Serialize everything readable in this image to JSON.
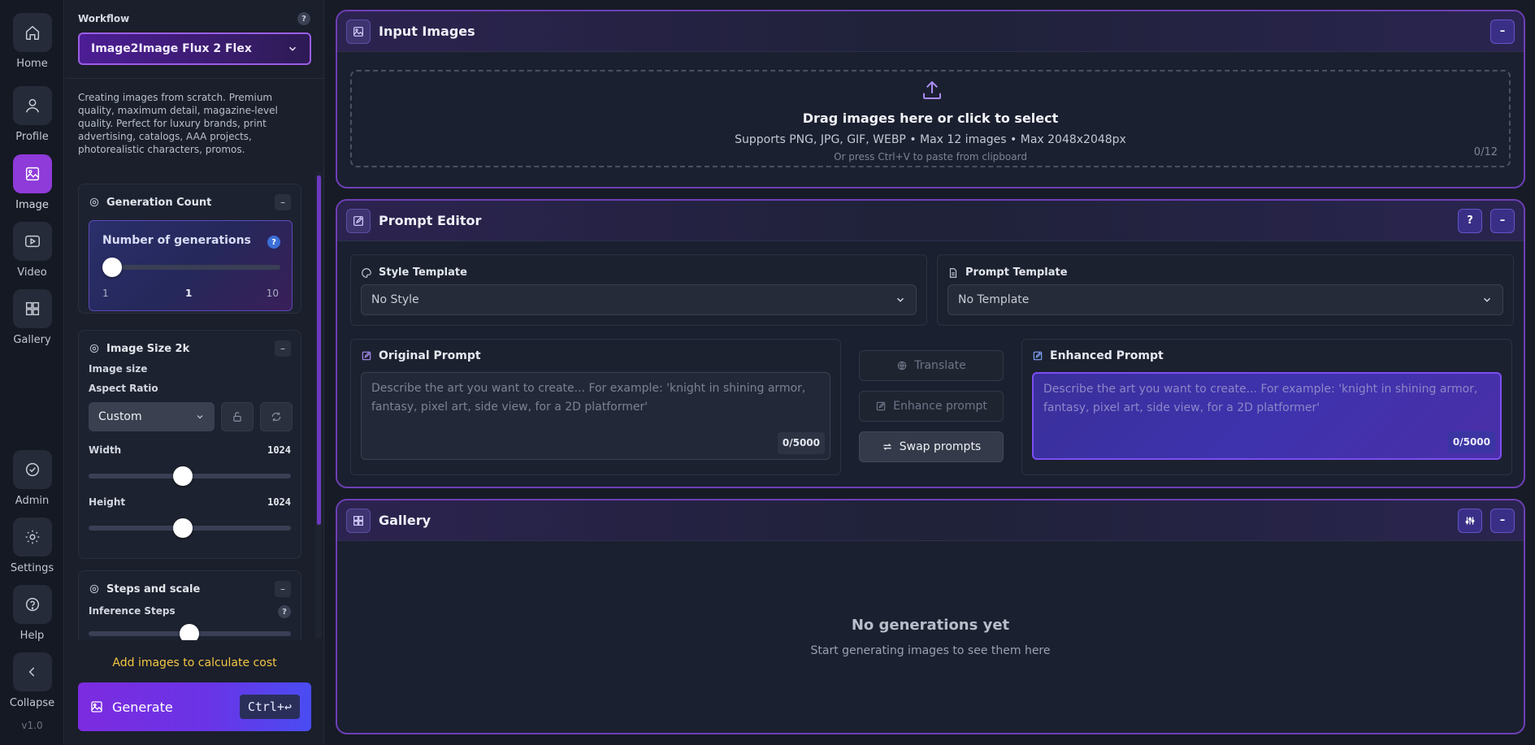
{
  "nav": {
    "items": [
      {
        "label": "Home",
        "icon": "home-icon"
      },
      {
        "label": "Profile",
        "icon": "user-icon"
      },
      {
        "label": "Image",
        "icon": "image-icon",
        "active": true
      },
      {
        "label": "Video",
        "icon": "video-icon"
      },
      {
        "label": "Gallery",
        "icon": "grid-icon"
      }
    ],
    "bottom": [
      {
        "label": "Admin",
        "icon": "check-circle-icon"
      },
      {
        "label": "Settings",
        "icon": "gear-icon"
      },
      {
        "label": "Help",
        "icon": "help-circle-icon"
      },
      {
        "label": "Collapse",
        "icon": "chevron-left-icon"
      }
    ],
    "version": "v1.0"
  },
  "sidebar": {
    "workflow_label": "Workflow",
    "help": "?",
    "workflow_value": "Image2Image Flux 2 Flex",
    "description": "Creating images from scratch. Premium quality, maximum detail, magazine-level quality. Perfect for luxury brands, print advertising, catalogs, AAA projects, photorealistic characters, promos.",
    "generation": {
      "title": "Generation Count",
      "collapse": "–",
      "label": "Number of generations",
      "help": "?",
      "min": "1",
      "value": "1",
      "max": "10",
      "fraction": 0.0
    },
    "image_size": {
      "title": "Image Size 2k",
      "collapse": "–",
      "subtitle": "Image size",
      "aspect_label": "Aspect Ratio",
      "aspect_value": "Custom",
      "width_label": "Width",
      "width_value": "1024",
      "width_fraction": 0.46,
      "height_label": "Height",
      "height_value": "1024",
      "height_fraction": 0.46
    },
    "steps": {
      "title": "Steps and scale",
      "collapse": "–",
      "inference_label": "Inference Steps",
      "help": "?"
    },
    "cost_text": "Add images to calculate cost",
    "generate_label": "Generate",
    "generate_shortcut": "Ctrl+↩"
  },
  "input_images": {
    "title": "Input Images",
    "collapse": "–",
    "drop_title": "Drag images here or click to select",
    "drop_sub": "Supports PNG, JPG, GIF, WEBP • Max 12 images • Max 2048x2048px",
    "drop_hint": "Or press Ctrl+V to paste from clipboard",
    "count": "0/12"
  },
  "prompt_editor": {
    "title": "Prompt Editor",
    "help": "?",
    "collapse": "–",
    "style_label": "Style Template",
    "style_value": "No Style",
    "template_label": "Prompt Template",
    "template_value": "No Template",
    "original_label": "Original Prompt",
    "original_placeholder": "Describe the art you want to create... For example: 'knight in shining armor, fantasy, pixel art, side view, for a 2D platformer'",
    "original_count": "0/5000",
    "translate_label": "Translate",
    "enhance_label": "Enhance prompt",
    "swap_label": "Swap prompts",
    "enhanced_label": "Enhanced Prompt",
    "enhanced_placeholder": "Describe the art you want to create... For example: 'knight in shining armor, fantasy, pixel art, side view, for a 2D platformer'",
    "enhanced_count": "0/5000"
  },
  "gallery": {
    "title": "Gallery",
    "collapse": "–",
    "empty_title": "No generations yet",
    "empty_sub": "Start generating images to see them here"
  },
  "colors": {
    "accent": "#8e3bd9",
    "section_border": "#6e3fb6",
    "cost_text": "#f5c542"
  }
}
